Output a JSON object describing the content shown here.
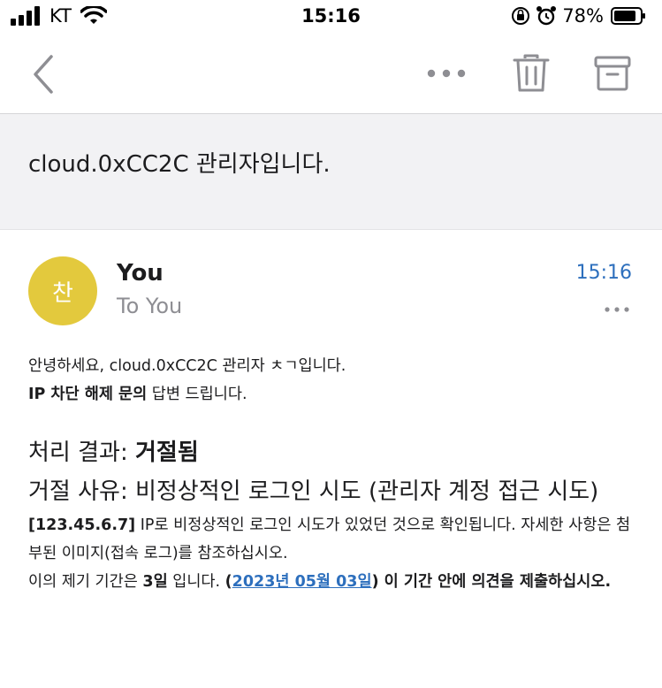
{
  "status_bar": {
    "carrier": "KT",
    "time": "15:16",
    "battery": "78%"
  },
  "email": {
    "subject": "cloud.0xCC2C 관리자입니다.",
    "sender": {
      "avatar_initial": "찬",
      "avatar_color": "#e3c93d",
      "name": "You",
      "to": "To You",
      "time": "15:16"
    },
    "body": {
      "greeting": "안녕하세요, cloud.0xCC2C 관리자 ㅊㄱ입니다.",
      "line2_bold": "IP 차단 해제 문의",
      "line2_rest": " 답변 드립니다.",
      "result_label": "처리 결과: ",
      "result_value": "거절됨",
      "reason": "거절 사유: 비정상적인 로그인 시도 (관리자 계정 접근 시도)",
      "ip": "[123.45.6.7]",
      "detail": " IP로 비정상적인 로그인 시도가 있었던 것으로 확인됩니다. 자세한 사항은 첨부된 이미지(접속 로그)를 참조하십시오.",
      "period_prefix": "이의 제기 기간은 ",
      "period_days": "3일",
      "period_mid": " 입니다. ",
      "paren_open": "(",
      "date_link": "2023년 05월 03일",
      "period_suffix": ") 이 기간 안에 의견을 제출하십시오."
    }
  },
  "colors": {
    "accent": "#2d6fbd",
    "toolbar_icon": "#8e8e93"
  }
}
